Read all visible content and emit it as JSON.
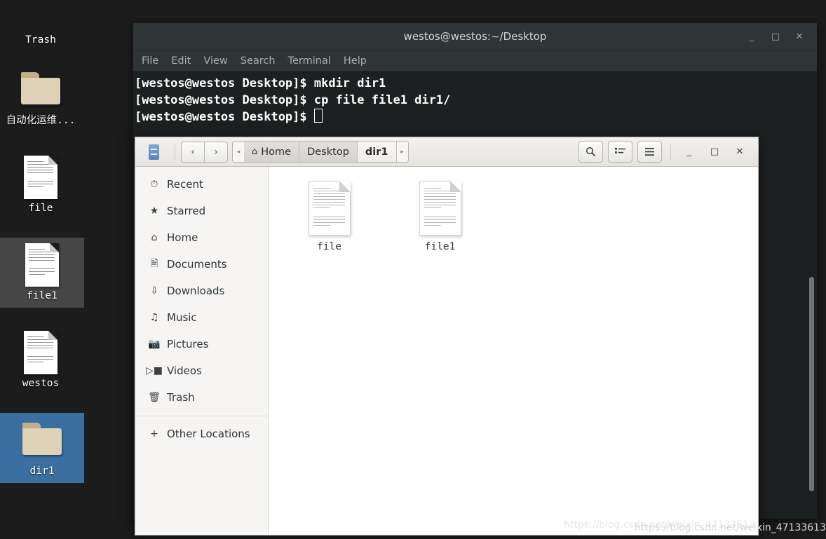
{
  "desktop": {
    "icons": [
      {
        "label": "Trash",
        "type": "trash-icon",
        "selected": "none"
      },
      {
        "label": "自动化运维...",
        "type": "folder-icon",
        "selected": "none"
      },
      {
        "label": "file",
        "type": "document-icon",
        "selected": "none"
      },
      {
        "label": "file1",
        "type": "document-icon",
        "selected": "gray"
      },
      {
        "label": "westos",
        "type": "document-icon",
        "selected": "none"
      },
      {
        "label": "dir1",
        "type": "folder-icon",
        "selected": "blue"
      }
    ],
    "background_color": "#1c1c1c",
    "selection_blue": "#3b6fa2",
    "selection_gray": "#464646"
  },
  "terminal": {
    "title": "westos@westos:~/Desktop",
    "menu": [
      "File",
      "Edit",
      "View",
      "Search",
      "Terminal",
      "Help"
    ],
    "window_buttons": {
      "minimize": "_",
      "maximize": "□",
      "close": "✕"
    },
    "lines": [
      "[westos@westos Desktop]$ mkdir dir1",
      "[westos@westos Desktop]$ cp file file1 dir1/",
      "[westos@westos Desktop]$ "
    ],
    "background_color": "#1d2021",
    "titlebar_color": "#2f3437",
    "text_color": "#ffffff"
  },
  "filemanager": {
    "app_icon": "files-cabinet-icon",
    "nav": {
      "back": "‹",
      "forward": "›"
    },
    "breadcrumbs": {
      "left_arrow": "◂",
      "right_arrow": "▸",
      "items": [
        {
          "label": "Home",
          "icon": "home-icon",
          "active": false
        },
        {
          "label": "Desktop",
          "icon": "",
          "active": false
        },
        {
          "label": "dir1",
          "icon": "",
          "active": true
        }
      ]
    },
    "toolbar": [
      {
        "name": "search-button",
        "glyph": "search-icon"
      },
      {
        "name": "view-list-button",
        "glyph": "list-view-icon"
      },
      {
        "name": "menu-button",
        "glyph": "hamburger-icon"
      }
    ],
    "window_buttons": {
      "minimize": "_",
      "maximize": "□",
      "close": "✕"
    },
    "sidebar": {
      "items": [
        {
          "label": "Recent",
          "icon": "clock-icon"
        },
        {
          "label": "Starred",
          "icon": "star-icon"
        },
        {
          "label": "Home",
          "icon": "home-icon"
        },
        {
          "label": "Documents",
          "icon": "document-icon"
        },
        {
          "label": "Downloads",
          "icon": "download-icon"
        },
        {
          "label": "Music",
          "icon": "music-note-icon"
        },
        {
          "label": "Pictures",
          "icon": "camera-icon"
        },
        {
          "label": "Videos",
          "icon": "video-icon"
        },
        {
          "label": "Trash",
          "icon": "trash-icon"
        }
      ],
      "other_locations": {
        "label": "Other Locations",
        "icon": "plus-icon"
      }
    },
    "files": [
      {
        "label": "file",
        "type": "document-icon"
      },
      {
        "label": "file1",
        "type": "document-icon"
      }
    ],
    "sidebar_color": "#f6f5f4",
    "content_color": "#ffffff"
  },
  "watermark": {
    "text": "https://blog.csdn.net/weixin_47133613"
  }
}
